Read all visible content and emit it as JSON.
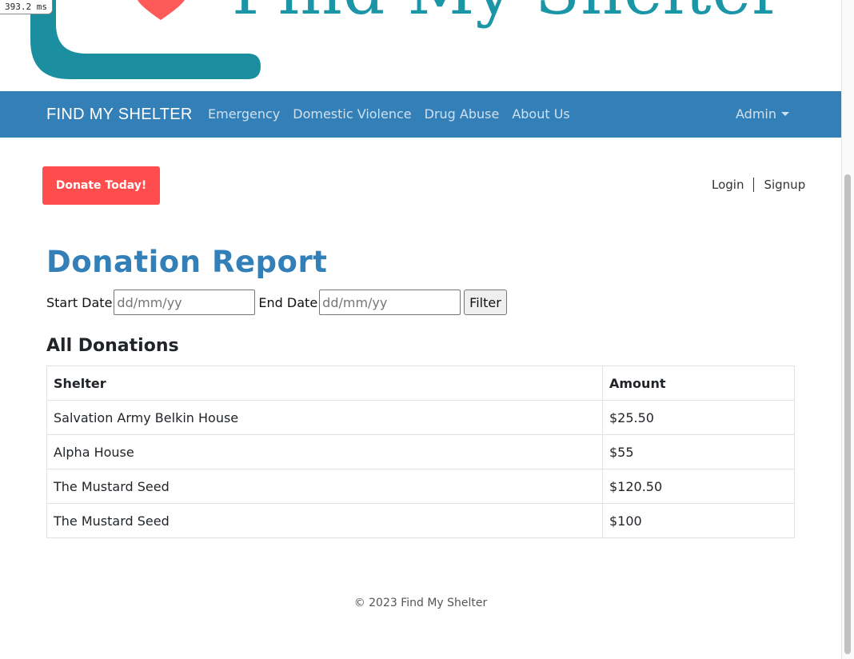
{
  "debug": {
    "timing": "393.2 ms"
  },
  "logo": {
    "text": "Find My Shelter"
  },
  "navbar": {
    "brand": "FIND MY SHELTER",
    "links": [
      "Emergency",
      "Domestic Violence",
      "Drug Abuse",
      "About Us"
    ],
    "admin": "Admin"
  },
  "actions": {
    "donate": "Donate Today!",
    "login": "Login",
    "signup": "Signup"
  },
  "report": {
    "title": "Donation Report",
    "start_label": "Start Date",
    "start_placeholder": "dd/mm/yy",
    "end_label": "End Date",
    "end_placeholder": "dd/mm/yy",
    "filter": "Filter"
  },
  "donations": {
    "title": "All Donations",
    "headers": [
      "Shelter",
      "Amount"
    ],
    "rows": [
      [
        "Salvation Army Belkin House",
        "$25.50"
      ],
      [
        "Alpha House",
        "$55"
      ],
      [
        "The Mustard Seed",
        "$120.50"
      ],
      [
        "The Mustard Seed",
        "$100"
      ]
    ]
  },
  "footer": "© 2023 Find My Shelter",
  "colors": {
    "navbar": "#337fb8",
    "donate": "#ff4c4c",
    "logo_teal": "#1b96a7",
    "title_blue": "#337fb8"
  }
}
